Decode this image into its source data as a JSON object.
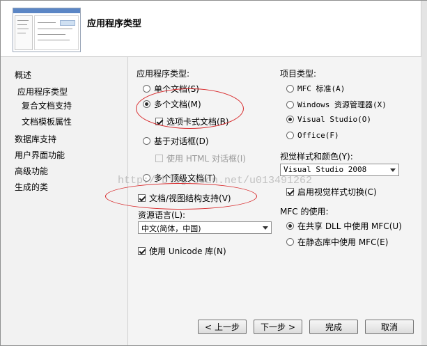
{
  "header": {
    "title": "应用程序类型"
  },
  "nav": {
    "items": [
      "概述",
      "应用程序类型",
      "复合文档支持",
      "文档模板属性",
      "数据库支持",
      "用户界面功能",
      "高级功能",
      "生成的类"
    ]
  },
  "app_type": {
    "label": "应用程序类型:",
    "single_doc": "单个文档(S)",
    "multi_doc": "多个文档(M)",
    "tabbed_docs": "选项卡式文档(B)",
    "dialog_based": "基于对话框(D)",
    "use_html_dialog": "使用 HTML 对话框(I)",
    "multi_top_level": "多个顶级文档(T)",
    "doc_view": "文档/视图结构支持(V)"
  },
  "resource_lang": {
    "label": "资源语言(L):",
    "value": "中文(简体，中国)"
  },
  "unicode": {
    "label": "使用 Unicode 库(N)"
  },
  "project_type": {
    "label": "项目类型:",
    "mfc_standard": "MFC 标准(A)",
    "windows_explorer": "Windows 资源管理器(X)",
    "visual_studio": "Visual Studio(O)",
    "office": "Office(F)"
  },
  "visual_style": {
    "label": "视觉样式和颜色(Y):",
    "value": "Visual Studio 2008",
    "enable_switch": "启用视觉样式切换(C)"
  },
  "mfc_use": {
    "label": "MFC 的使用:",
    "shared_dll": "在共享 DLL 中使用 MFC(U)",
    "static_lib": "在静态库中使用 MFC(E)"
  },
  "buttons": {
    "prev": "上一步",
    "next": "下一步",
    "finish": "完成",
    "cancel": "取消"
  },
  "watermark": "http://blog.csdn.net/u013491262"
}
